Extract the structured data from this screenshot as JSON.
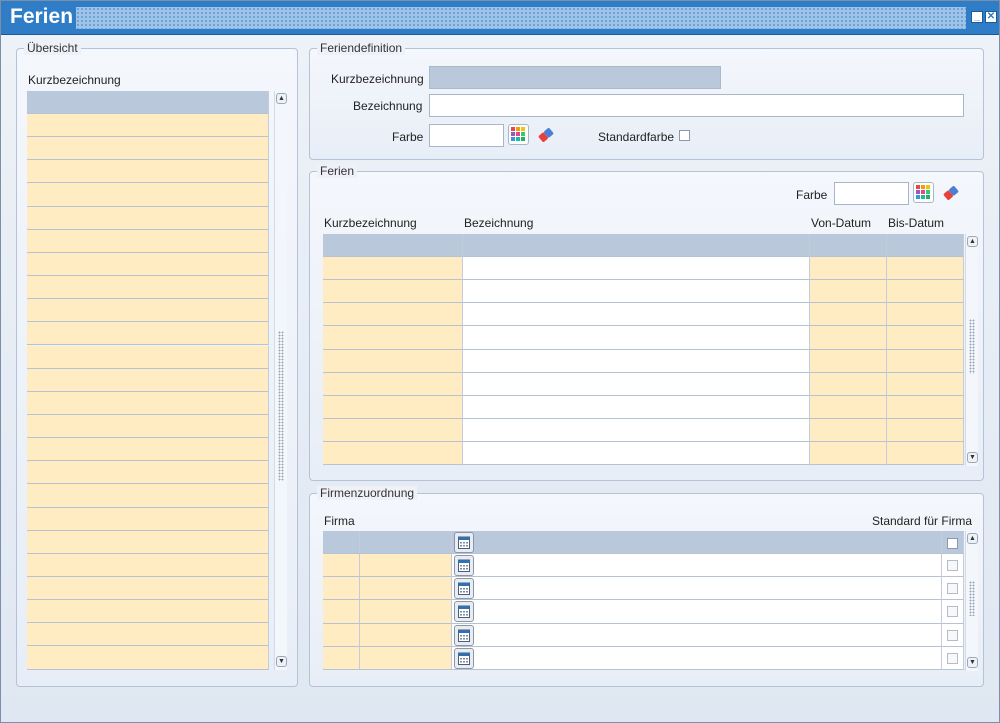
{
  "window": {
    "title": "Ferien"
  },
  "overview": {
    "legend": "Übersicht",
    "column_header": "Kurzbezeichnung",
    "row_count": 24
  },
  "definition": {
    "legend": "Feriendefinition",
    "short_label": "Kurzbezeichnung",
    "short_value": "",
    "name_label": "Bezeichnung",
    "name_value": "",
    "color_label": "Farbe",
    "color_value": "",
    "default_color_label": "Standardfarbe",
    "default_color_checked": false
  },
  "holidays": {
    "legend": "Ferien",
    "color_label": "Farbe",
    "color_value": "",
    "columns": [
      "Kurzbezeichnung",
      "Bezeichnung",
      "Von-Datum",
      "Bis-Datum"
    ],
    "row_count": 9
  },
  "companies": {
    "legend": "Firmenzuordnung",
    "company_label": "Firma",
    "default_label": "Standard für Firma",
    "row_count": 5
  },
  "icons": {
    "palette": "color-palette-icon",
    "eraser": "eraser-icon",
    "calendar": "calendar-icon",
    "minimize": "minimize-icon",
    "close": "close-icon"
  },
  "colors": {
    "titlebar": "#2f7cc7",
    "header_cell": "#b9c8da",
    "editable_cell": "#ffecc2"
  }
}
